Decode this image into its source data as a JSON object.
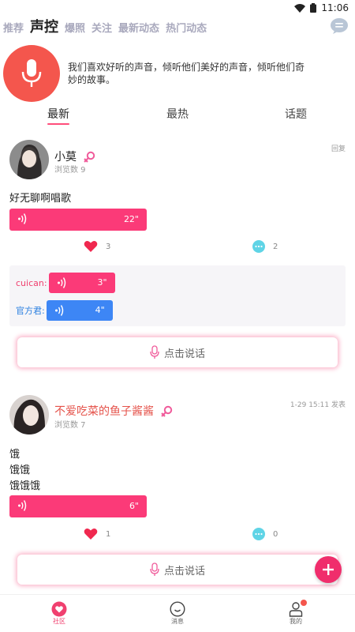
{
  "status_bar": {
    "time": "11:06"
  },
  "top_tabs": [
    {
      "label": "推荐"
    },
    {
      "label": "声控",
      "active": true
    },
    {
      "label": "爆照"
    },
    {
      "label": "关注"
    },
    {
      "label": "最新动态"
    },
    {
      "label": "热门动态"
    }
  ],
  "intro": {
    "text": "我们喜欢好听的声音，倾听他们美好的声音，倾听他们奇妙的故事。"
  },
  "sub_tabs": [
    {
      "label": "最新",
      "active": true
    },
    {
      "label": "最热"
    },
    {
      "label": "话题"
    }
  ],
  "posts": [
    {
      "username": "小莫",
      "views": "浏览数 9",
      "meta": "回复",
      "content": [
        "好无聊啊唱歌"
      ],
      "voice_duration": "22\"",
      "likes": "3",
      "comments": "2",
      "replies": [
        {
          "name": "cuican:",
          "duration": "3\""
        },
        {
          "name": "官方君:",
          "duration": "4\""
        }
      ],
      "speak_label": "点击说话"
    },
    {
      "username": "不爱吃菜的鱼子酱酱",
      "views": "浏览数 7",
      "meta": "1-29 15:11 发表",
      "content": [
        "饿",
        "饿饿",
        "饿饿饿"
      ],
      "voice_duration": "6\"",
      "likes": "1",
      "comments": "0",
      "speak_label": "点击说话"
    }
  ],
  "bottom_nav": [
    {
      "label": "社区",
      "active": true
    },
    {
      "label": "消息"
    },
    {
      "label": "我的"
    }
  ],
  "colors": {
    "accent": "#fb3a78",
    "blue": "#3d86f5",
    "mic": "#f4564d"
  }
}
